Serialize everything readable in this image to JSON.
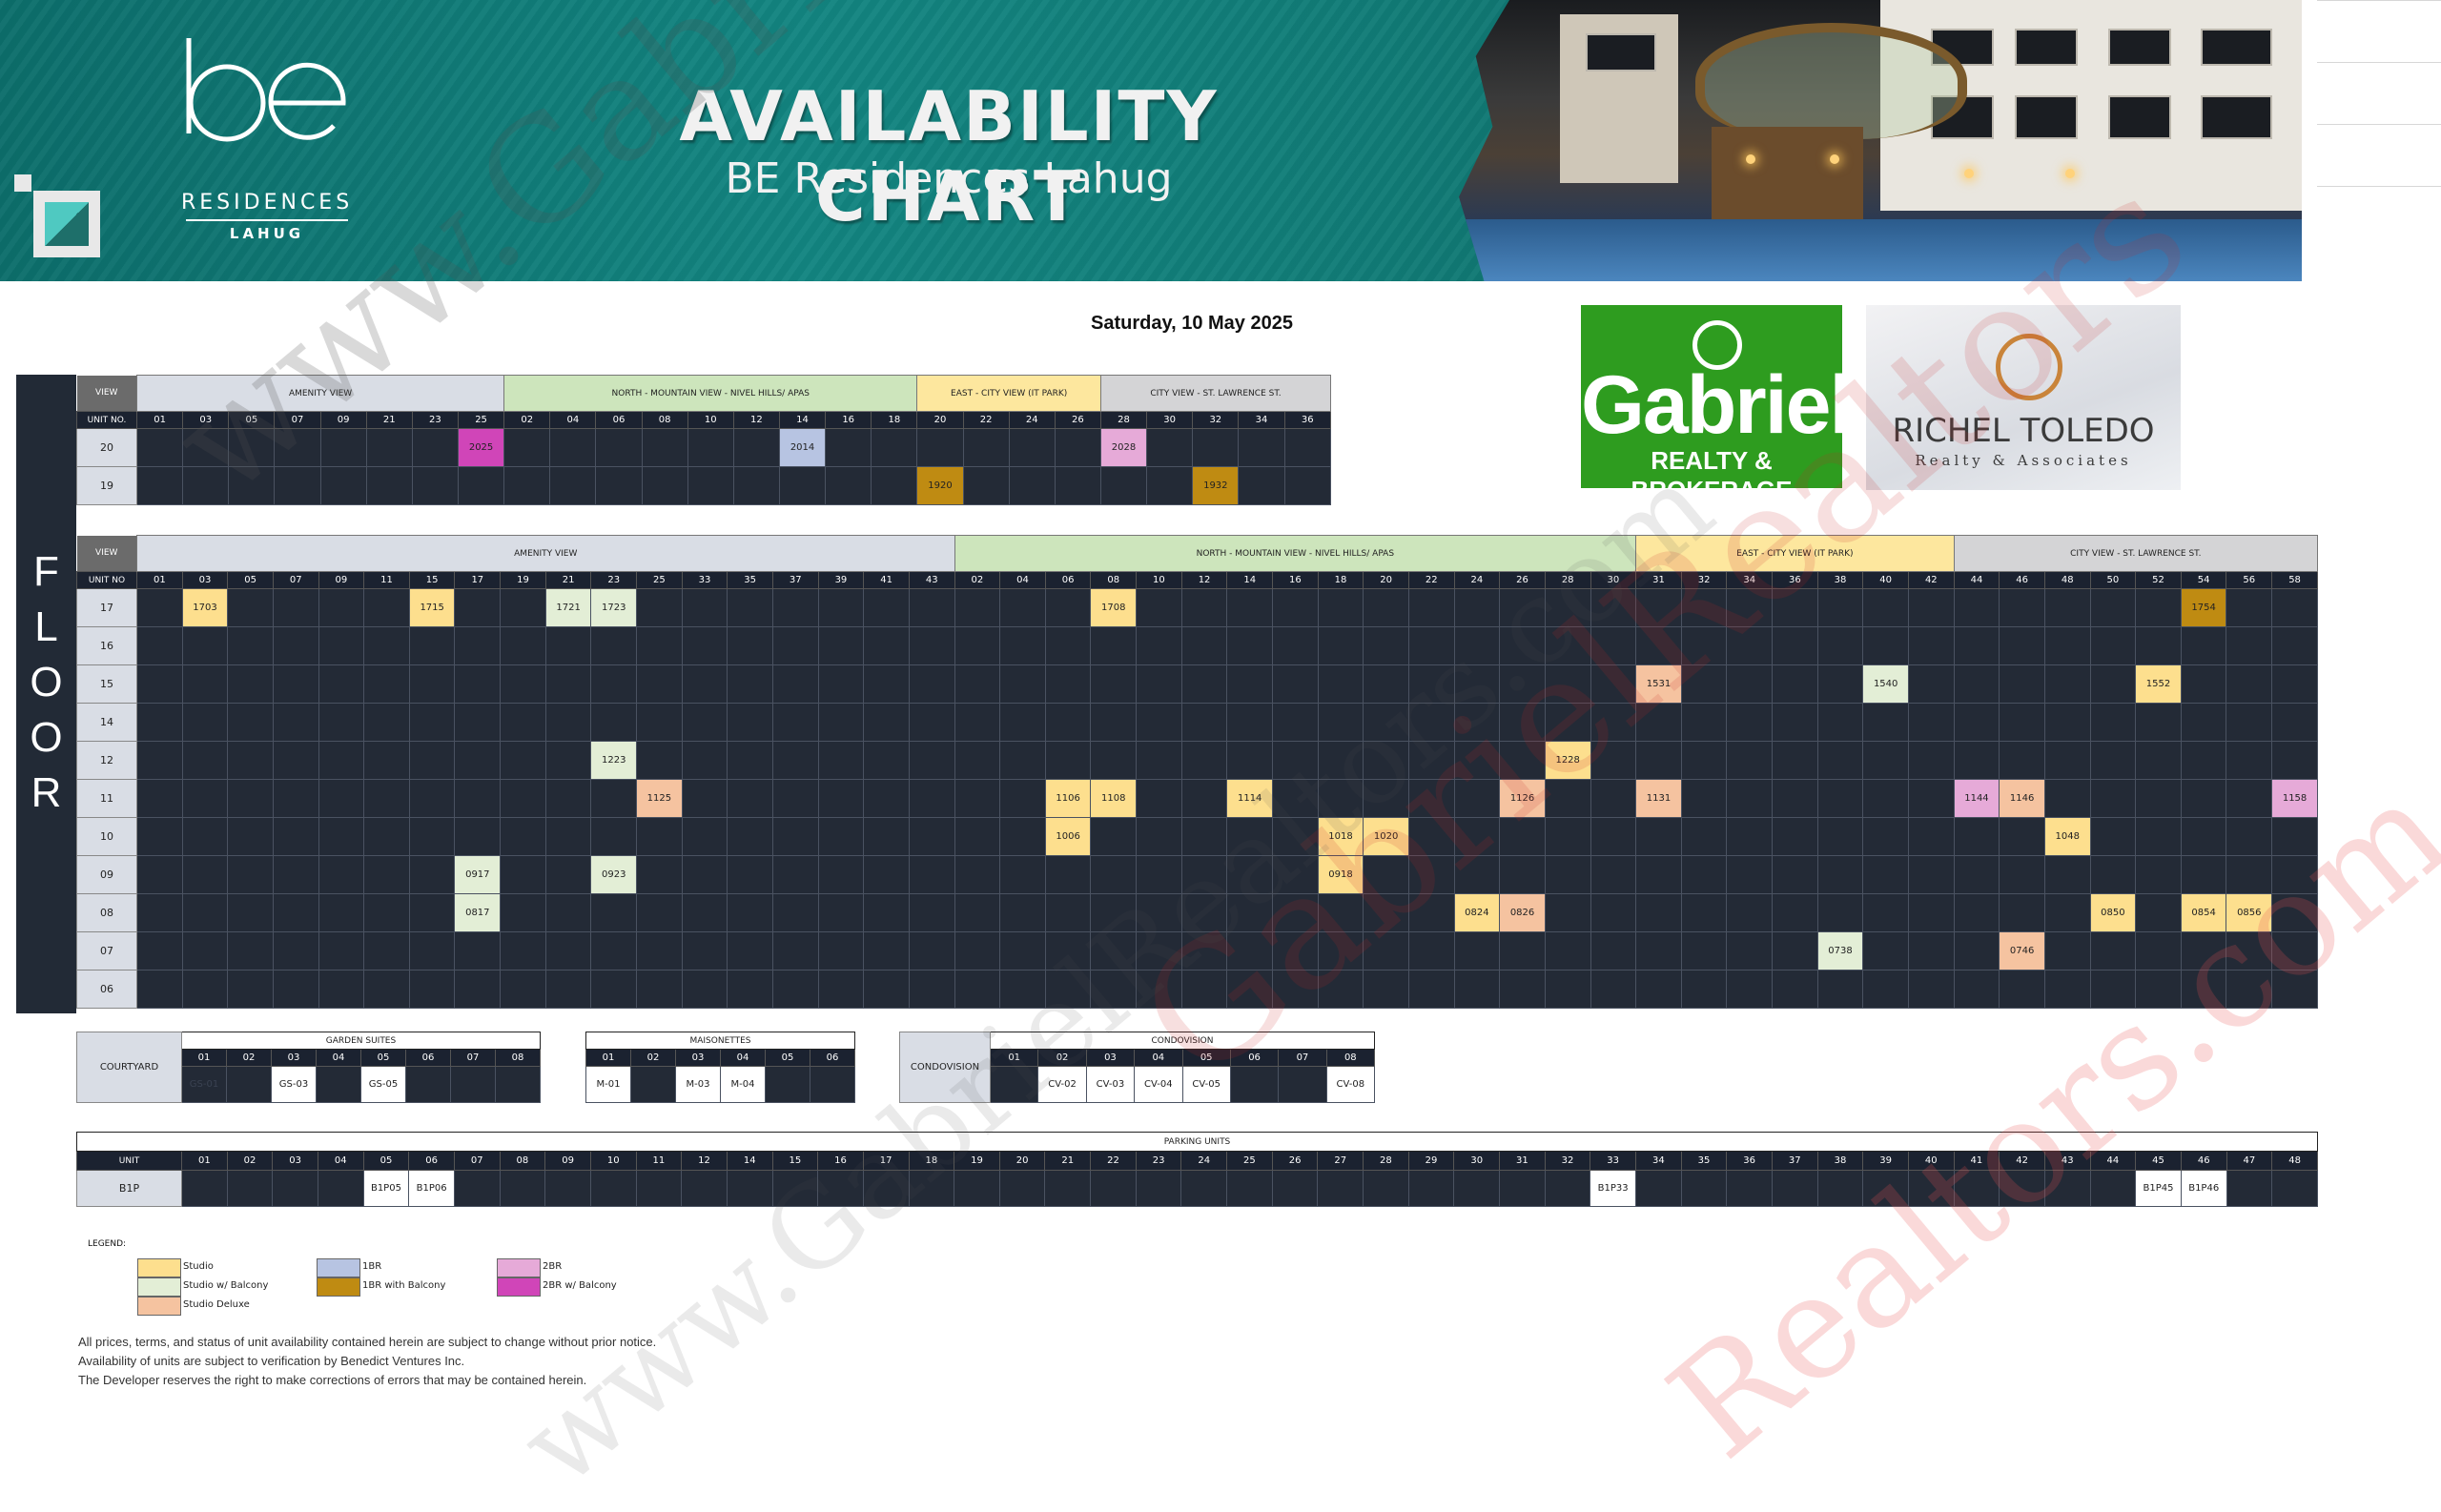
{
  "header": {
    "title": "AVAILABILITY CHART",
    "subtitle": "BE Residences Lahug",
    "brand_residences": "RESIDENCES",
    "brand_lahug": "LAHUG"
  },
  "date": "Saturday, 10 May 2025",
  "logos": {
    "gabriel_name": "Gabriel",
    "gabriel_tag": "REALTY & BROKERAGE",
    "richel_name": "RICHEL TOLEDO",
    "richel_tag": "Realty & Associates"
  },
  "upper": {
    "view_label": "VIEW",
    "unit_label": "UNIT NO.",
    "views": [
      {
        "label": "AMENITY VIEW",
        "span": 8,
        "cls": "v-amenity"
      },
      {
        "label": "NORTH - MOUNTAIN VIEW - NIVEL HILLS/ APAS",
        "span": 9,
        "cls": "v-north"
      },
      {
        "label": "EAST - CITY VIEW (IT PARK)",
        "span": 4,
        "cls": "v-east"
      },
      {
        "label": "CITY VIEW - ST. LAWRENCE ST.",
        "span": 5,
        "cls": "v-city"
      }
    ],
    "units": [
      "01",
      "03",
      "05",
      "07",
      "09",
      "21",
      "23",
      "25",
      "02",
      "04",
      "06",
      "08",
      "10",
      "12",
      "14",
      "16",
      "18",
      "20",
      "22",
      "24",
      "26",
      "28",
      "30",
      "32",
      "34",
      "36"
    ],
    "rows": [
      {
        "floor": "20",
        "cells": {
          "25": [
            "2025",
            "c-2br-balcony"
          ],
          "14": [
            "2014",
            "c-1br"
          ],
          "28": [
            "2028",
            "c-2br"
          ]
        }
      },
      {
        "floor": "19",
        "cells": {
          "20": [
            "1920",
            "c-1br-balcony"
          ],
          "32": [
            "1932",
            "c-1br-balcony"
          ]
        }
      }
    ]
  },
  "main": {
    "view_label": "VIEW",
    "unit_label": "UNIT NO",
    "views": [
      {
        "label": "AMENITY VIEW",
        "span": 18,
        "cls": "v-amenity"
      },
      {
        "label": "NORTH - MOUNTAIN VIEW - NIVEL HILLS/ APAS",
        "span": 15,
        "cls": "v-north"
      },
      {
        "label": "EAST - CITY VIEW (IT PARK)",
        "span": 7,
        "cls": "v-east"
      },
      {
        "label": "CITY VIEW - ST. LAWRENCE ST.",
        "span": 8,
        "cls": "v-city"
      }
    ],
    "units": [
      "01",
      "03",
      "05",
      "07",
      "09",
      "11",
      "15",
      "17",
      "19",
      "21",
      "23",
      "25",
      "33",
      "35",
      "37",
      "39",
      "41",
      "43",
      "02",
      "04",
      "06",
      "08",
      "10",
      "12",
      "14",
      "16",
      "18",
      "20",
      "22",
      "24",
      "26",
      "28",
      "30",
      "31",
      "32",
      "34",
      "36",
      "38",
      "40",
      "42",
      "44",
      "46",
      "48",
      "50",
      "52",
      "54",
      "56",
      "58"
    ],
    "rows": [
      {
        "floor": "17",
        "cells": {
          "03": [
            "1703",
            "c-studio"
          ],
          "15": [
            "1715",
            "c-studio"
          ],
          "21": [
            "1721",
            "c-studio-balcony"
          ],
          "23": [
            "1723",
            "c-studio-balcony"
          ],
          "08": [
            "1708",
            "c-studio"
          ],
          "54": [
            "1754",
            "c-1br-balcony"
          ]
        }
      },
      {
        "floor": "16",
        "cells": {}
      },
      {
        "floor": "15",
        "cells": {
          "31": [
            "1531",
            "c-studio-deluxe"
          ],
          "40": [
            "1540",
            "c-studio-balcony"
          ],
          "52": [
            "1552",
            "c-studio"
          ]
        }
      },
      {
        "floor": "14",
        "cells": {}
      },
      {
        "floor": "12",
        "cells": {
          "23": [
            "1223",
            "c-studio-balcony"
          ],
          "28": [
            "1228",
            "c-studio"
          ]
        }
      },
      {
        "floor": "11",
        "cells": {
          "25": [
            "1125",
            "c-studio-deluxe"
          ],
          "06": [
            "1106",
            "c-studio"
          ],
          "08": [
            "1108",
            "c-studio"
          ],
          "14": [
            "1114",
            "c-studio"
          ],
          "26": [
            "1126",
            "c-studio-deluxe"
          ],
          "31": [
            "1131",
            "c-studio-deluxe"
          ],
          "44": [
            "1144",
            "c-2br"
          ],
          "46": [
            "1146",
            "c-studio-deluxe"
          ],
          "58": [
            "1158",
            "c-2br"
          ]
        }
      },
      {
        "floor": "10",
        "cells": {
          "06": [
            "1006",
            "c-studio"
          ],
          "18": [
            "1018",
            "c-studio"
          ],
          "20": [
            "1020",
            "c-studio"
          ],
          "48": [
            "1048",
            "c-studio"
          ]
        }
      },
      {
        "floor": "09",
        "cells": {
          "17": [
            "0917",
            "c-studio-balcony"
          ],
          "23": [
            "0923",
            "c-studio-balcony"
          ],
          "18": [
            "0918",
            "c-studio"
          ]
        }
      },
      {
        "floor": "08",
        "cells": {
          "17": [
            "0817",
            "c-studio-balcony"
          ],
          "24": [
            "0824",
            "c-studio"
          ],
          "26": [
            "0826",
            "c-studio-deluxe"
          ],
          "50": [
            "0850",
            "c-studio"
          ],
          "54": [
            "0854",
            "c-studio"
          ],
          "56": [
            "0856",
            "c-studio"
          ]
        }
      },
      {
        "floor": "07",
        "cells": {
          "38": [
            "0738",
            "c-studio-balcony"
          ],
          "46": [
            "0746",
            "c-studio-deluxe"
          ]
        }
      },
      {
        "floor": "06",
        "cells": {}
      }
    ],
    "floor_letters": [
      "F",
      "L",
      "O",
      "O",
      "R"
    ]
  },
  "garden": {
    "row_label": "COURTYARD",
    "title": "GARDEN SUITES",
    "units": [
      "01",
      "02",
      "03",
      "04",
      "05",
      "06",
      "07",
      "08"
    ],
    "cells": {
      "01": [
        "GS-01",
        "dark"
      ],
      "03": [
        "GS-03",
        "c-white"
      ],
      "05": [
        "GS-05",
        "c-white"
      ]
    }
  },
  "maison": {
    "title": "MAISONETTES",
    "units": [
      "01",
      "02",
      "03",
      "04",
      "05",
      "06"
    ],
    "cells": {
      "01": [
        "M-01",
        "c-white"
      ],
      "03": [
        "M-03",
        "c-white"
      ],
      "04": [
        "M-04",
        "c-white"
      ]
    }
  },
  "condo": {
    "row_label": "CONDOVISION",
    "title": "CONDOVISION",
    "units": [
      "01",
      "02",
      "03",
      "04",
      "05",
      "06",
      "07",
      "08"
    ],
    "cells": {
      "02": [
        "CV-02",
        "c-white"
      ],
      "03": [
        "CV-03",
        "c-white"
      ],
      "04": [
        "CV-04",
        "c-white"
      ],
      "05": [
        "CV-05",
        "c-white"
      ],
      "08": [
        "CV-08",
        "c-white"
      ]
    }
  },
  "parking": {
    "title": "PARKING UNITS",
    "unit_label": "UNIT",
    "row_label": "B1P",
    "units": [
      "01",
      "02",
      "03",
      "04",
      "05",
      "06",
      "07",
      "08",
      "09",
      "10",
      "11",
      "12",
      "14",
      "15",
      "16",
      "17",
      "18",
      "19",
      "20",
      "21",
      "22",
      "23",
      "24",
      "25",
      "26",
      "27",
      "28",
      "29",
      "30",
      "31",
      "32",
      "33",
      "34",
      "35",
      "36",
      "37",
      "38",
      "39",
      "40",
      "41",
      "42",
      "43",
      "44",
      "45",
      "46",
      "47",
      "48"
    ],
    "cells": {
      "05": [
        "B1P05",
        "c-white"
      ],
      "06": [
        "B1P06",
        "c-white"
      ],
      "33": [
        "B1P33",
        "c-white"
      ],
      "45": [
        "B1P45",
        "c-white"
      ],
      "46": [
        "B1P46",
        "c-white"
      ]
    }
  },
  "legend": {
    "title": "LEGEND:",
    "items": [
      {
        "label": "Studio",
        "cls": "c-studio"
      },
      {
        "label": "Studio w/ Balcony",
        "cls": "c-studio-balcony"
      },
      {
        "label": "Studio Deluxe",
        "cls": "c-studio-deluxe"
      },
      {
        "label": "1BR",
        "cls": "c-1br"
      },
      {
        "label": "1BR with Balcony",
        "cls": "c-1br-balcony"
      },
      {
        "label": "2BR",
        "cls": "c-2br"
      },
      {
        "label": "2BR w/ Balcony",
        "cls": "c-2br-balcony"
      }
    ]
  },
  "notes": [
    "All prices, terms, and status of unit availability contained herein are subject to change without prior notice.",
    "Availability of units are subject to verification by Benedict Ventures Inc.",
    "The Developer reserves the right to make corrections of errors that may be contained herein."
  ],
  "watermarks": [
    "www.Gabriel",
    "GabrielRealtors",
    "Realtors.com",
    "www.GabrielRealtors.com"
  ]
}
